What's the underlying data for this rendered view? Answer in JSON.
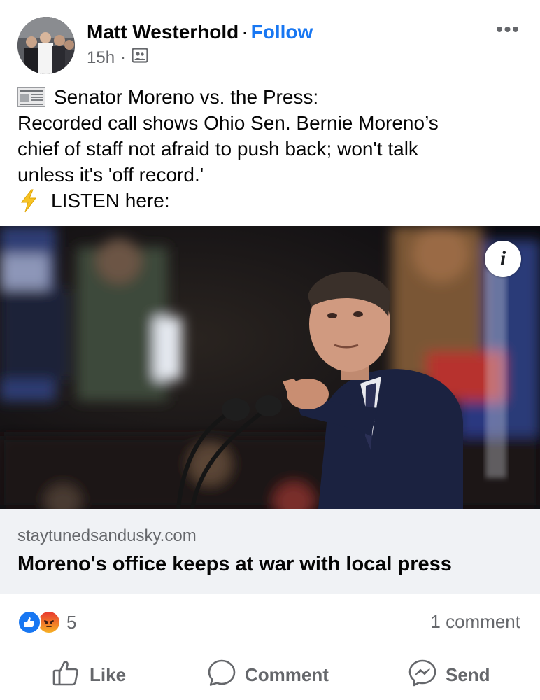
{
  "post": {
    "author": "Matt Westerhold",
    "separator": "·",
    "follow_label": "Follow",
    "time": "15h",
    "time_separator": "·",
    "audience_icon": "friends-photo-icon",
    "more_icon": "more-options-icon",
    "more_label": "•••",
    "text_lines": [
      "Senator Moreno vs. the Press:",
      "Recorded call shows Ohio Sen. Bernie Moreno’s",
      "chief of staff not afraid to push back; won't talk",
      "unless it's 'off record.'",
      "LISTEN here:"
    ]
  },
  "link_preview": {
    "info_label": "i",
    "domain": "staytunedsandusky.com",
    "title": "Moreno's office keeps at war with local press"
  },
  "engagement": {
    "reaction_count": "5",
    "comment_count": "1 comment"
  },
  "actions": {
    "like": "Like",
    "comment": "Comment",
    "send": "Send"
  },
  "colors": {
    "accent": "#1877f2",
    "muted": "#65676b",
    "card_bg": "#f0f2f5"
  }
}
